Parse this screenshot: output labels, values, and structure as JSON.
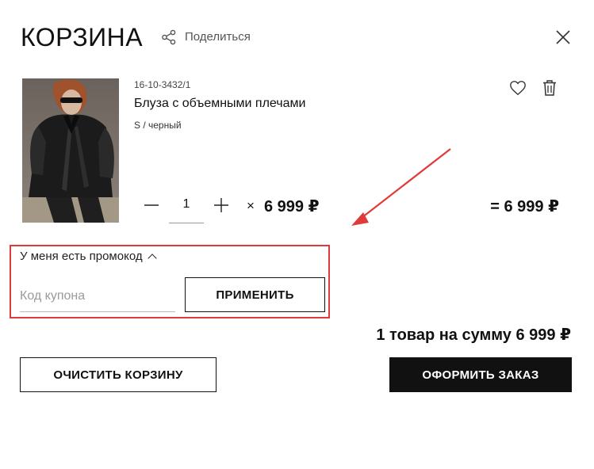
{
  "header": {
    "title": "КОРЗИНА",
    "share_label": "Поделиться",
    "share_icon": "share-icon",
    "close_icon": "close-icon"
  },
  "cart_item": {
    "sku": "16-10-3432/1",
    "name": "Блуза с объемными плечами",
    "variant": "S / черный",
    "quantity": "1",
    "times_sign": "×",
    "unit_price": "6 999 ₽",
    "line_total": "= 6 999 ₽",
    "icons": {
      "favorite": "heart-icon",
      "delete": "trash-icon",
      "decrease": "minus-icon",
      "increase": "plus-icon"
    }
  },
  "promo": {
    "toggle_label": "У меня есть промокод",
    "expanded": true,
    "coupon_placeholder": "Код купона",
    "coupon_value": "",
    "apply_label": "ПРИМЕНИТЬ",
    "highlight_color": "#e03a3a"
  },
  "summary": {
    "text": "1 товар на сумму 6 999 ₽"
  },
  "actions": {
    "clear_label": "ОЧИСТИТЬ КОРЗИНУ",
    "checkout_label": "ОФОРМИТЬ ЗАКАЗ"
  },
  "colors": {
    "accent": "#111111",
    "annotation": "#e03a3a"
  }
}
